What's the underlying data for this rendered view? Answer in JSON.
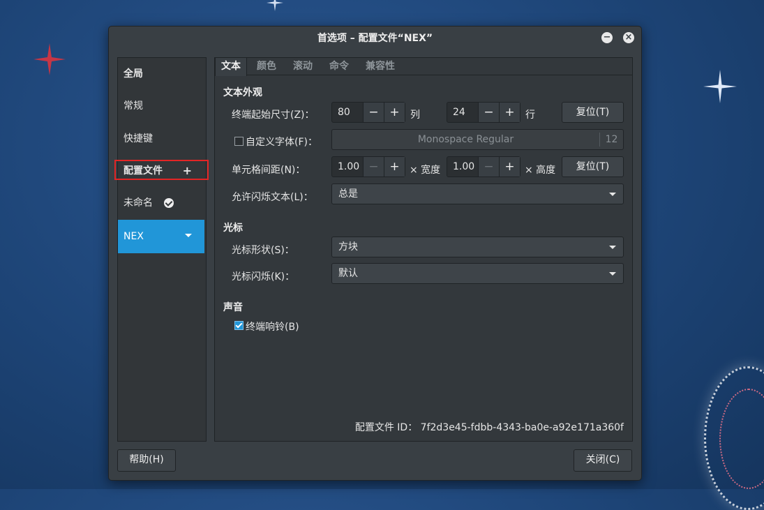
{
  "window": {
    "title": "首选项 – 配置文件“NEX”"
  },
  "titlebar_buttons": {
    "minimize": "−",
    "close": "×"
  },
  "sidebar": {
    "global": "全局",
    "general": "常规",
    "shortcuts": "快捷键",
    "profiles": "配置文件",
    "profiles_add": "+",
    "unnamed": "未命名",
    "nex": "NEX"
  },
  "tabs": [
    "文本",
    "颜色",
    "滚动",
    "命令",
    "兼容性"
  ],
  "text_tab": {
    "section_appearance": "文本外观",
    "size_label": "终端起始尺寸(Z)：",
    "cols_value": "80",
    "cols_unit": "列",
    "rows_value": "24",
    "rows_unit": "行",
    "reset_label": "复位(T)",
    "custom_font_label": "自定义字体(F)：",
    "custom_font_checked": false,
    "font_name": "Monospace Regular",
    "font_size": "12",
    "cell_spacing_label": "单元格间距(N)：",
    "width_value": "1.00",
    "width_unit": "× 宽度",
    "height_value": "1.00",
    "height_unit": "× 高度",
    "reset2_label": "复位(T)",
    "blink_text_label": "允许闪烁文本(L)：",
    "blink_text_value": "总是",
    "section_cursor": "光标",
    "cursor_shape_label": "光标形状(S)：",
    "cursor_shape_value": "方块",
    "cursor_blink_label": "光标闪烁(K)：",
    "cursor_blink_value": "默认",
    "section_sound": "声音",
    "bell_label": "终端响铃(B)",
    "bell_checked": true,
    "profile_id_label": "配置文件 ID：",
    "profile_id_value": "7f2d3e45-fdbb-4343-ba0e-a92e171a360f"
  },
  "spin_glyphs": {
    "minus": "−",
    "plus": "+"
  },
  "footer": {
    "help": "帮助(H)",
    "close": "关闭(C)"
  },
  "colors": {
    "accent": "#2196d8",
    "highlight": "#e32525",
    "window_bg": "#393f44"
  }
}
